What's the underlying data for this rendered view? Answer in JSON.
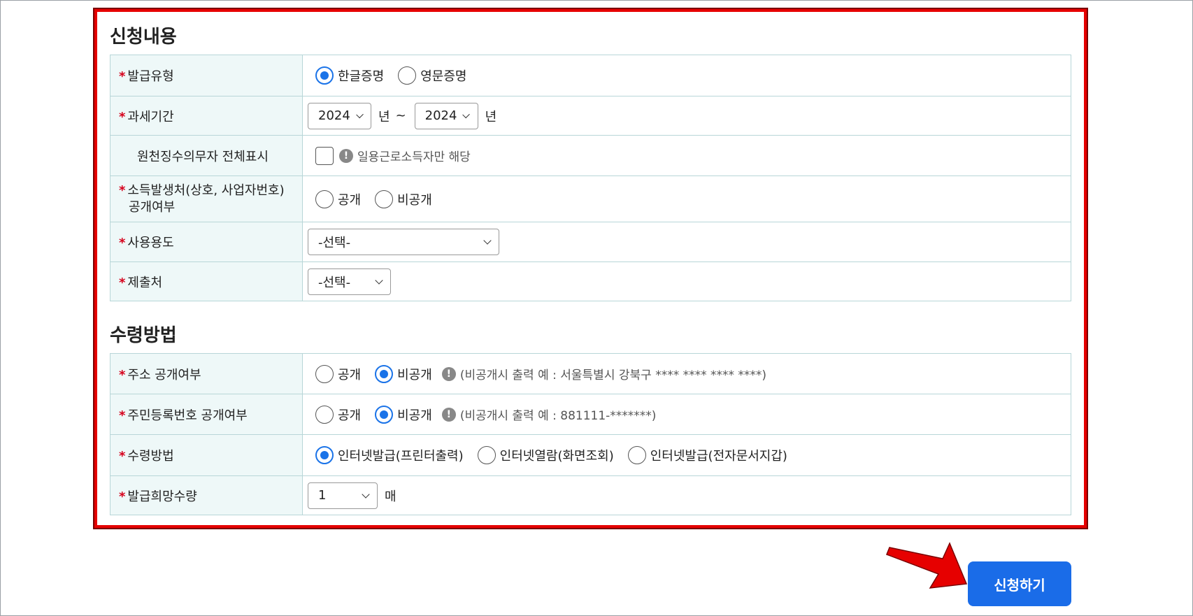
{
  "section1": {
    "title": "신청내용",
    "issue_type": {
      "label": "발급유형",
      "options": [
        "한글증명",
        "영문증명"
      ],
      "selected": 0
    },
    "tax_period": {
      "label": "과세기간",
      "from": "2024",
      "to": "2024",
      "unit": "년",
      "tilde": "~"
    },
    "withholding": {
      "label": "원천징수의무자 전체표시",
      "checked": false,
      "note": "일용근로소득자만 해당"
    },
    "income_source": {
      "label_line1": "소득발생처(상호, 사업자번호)",
      "label_line2": "공개여부",
      "options": [
        "공개",
        "비공개"
      ],
      "selected": null
    },
    "purpose": {
      "label": "사용용도",
      "value": "-선택-"
    },
    "submit_to": {
      "label": "제출처",
      "value": "-선택-"
    }
  },
  "section2": {
    "title": "수령방법",
    "address": {
      "label": "주소 공개여부",
      "options": [
        "공개",
        "비공개"
      ],
      "selected": 1,
      "note": "(비공개시 출력 예 : 서울특별시 강북구 **** **** **** ****)"
    },
    "rrn": {
      "label": "주민등록번호 공개여부",
      "options": [
        "공개",
        "비공개"
      ],
      "selected": 1,
      "note": "(비공개시 출력 예 : 881111-*******)"
    },
    "method": {
      "label": "수령방법",
      "options": [
        "인터넷발급(프린터출력)",
        "인터넷열람(화면조회)",
        "인터넷발급(전자문서지갑)"
      ],
      "selected": 0
    },
    "quantity": {
      "label": "발급희망수량",
      "value": "1",
      "unit": "매"
    }
  },
  "required_mark": "*",
  "info_glyph": "!",
  "submit_button": {
    "label": "신청하기",
    "color": "#1a6ce8"
  },
  "annotation": {
    "box_color": "#e60000",
    "arrow_color": "#e60000"
  }
}
